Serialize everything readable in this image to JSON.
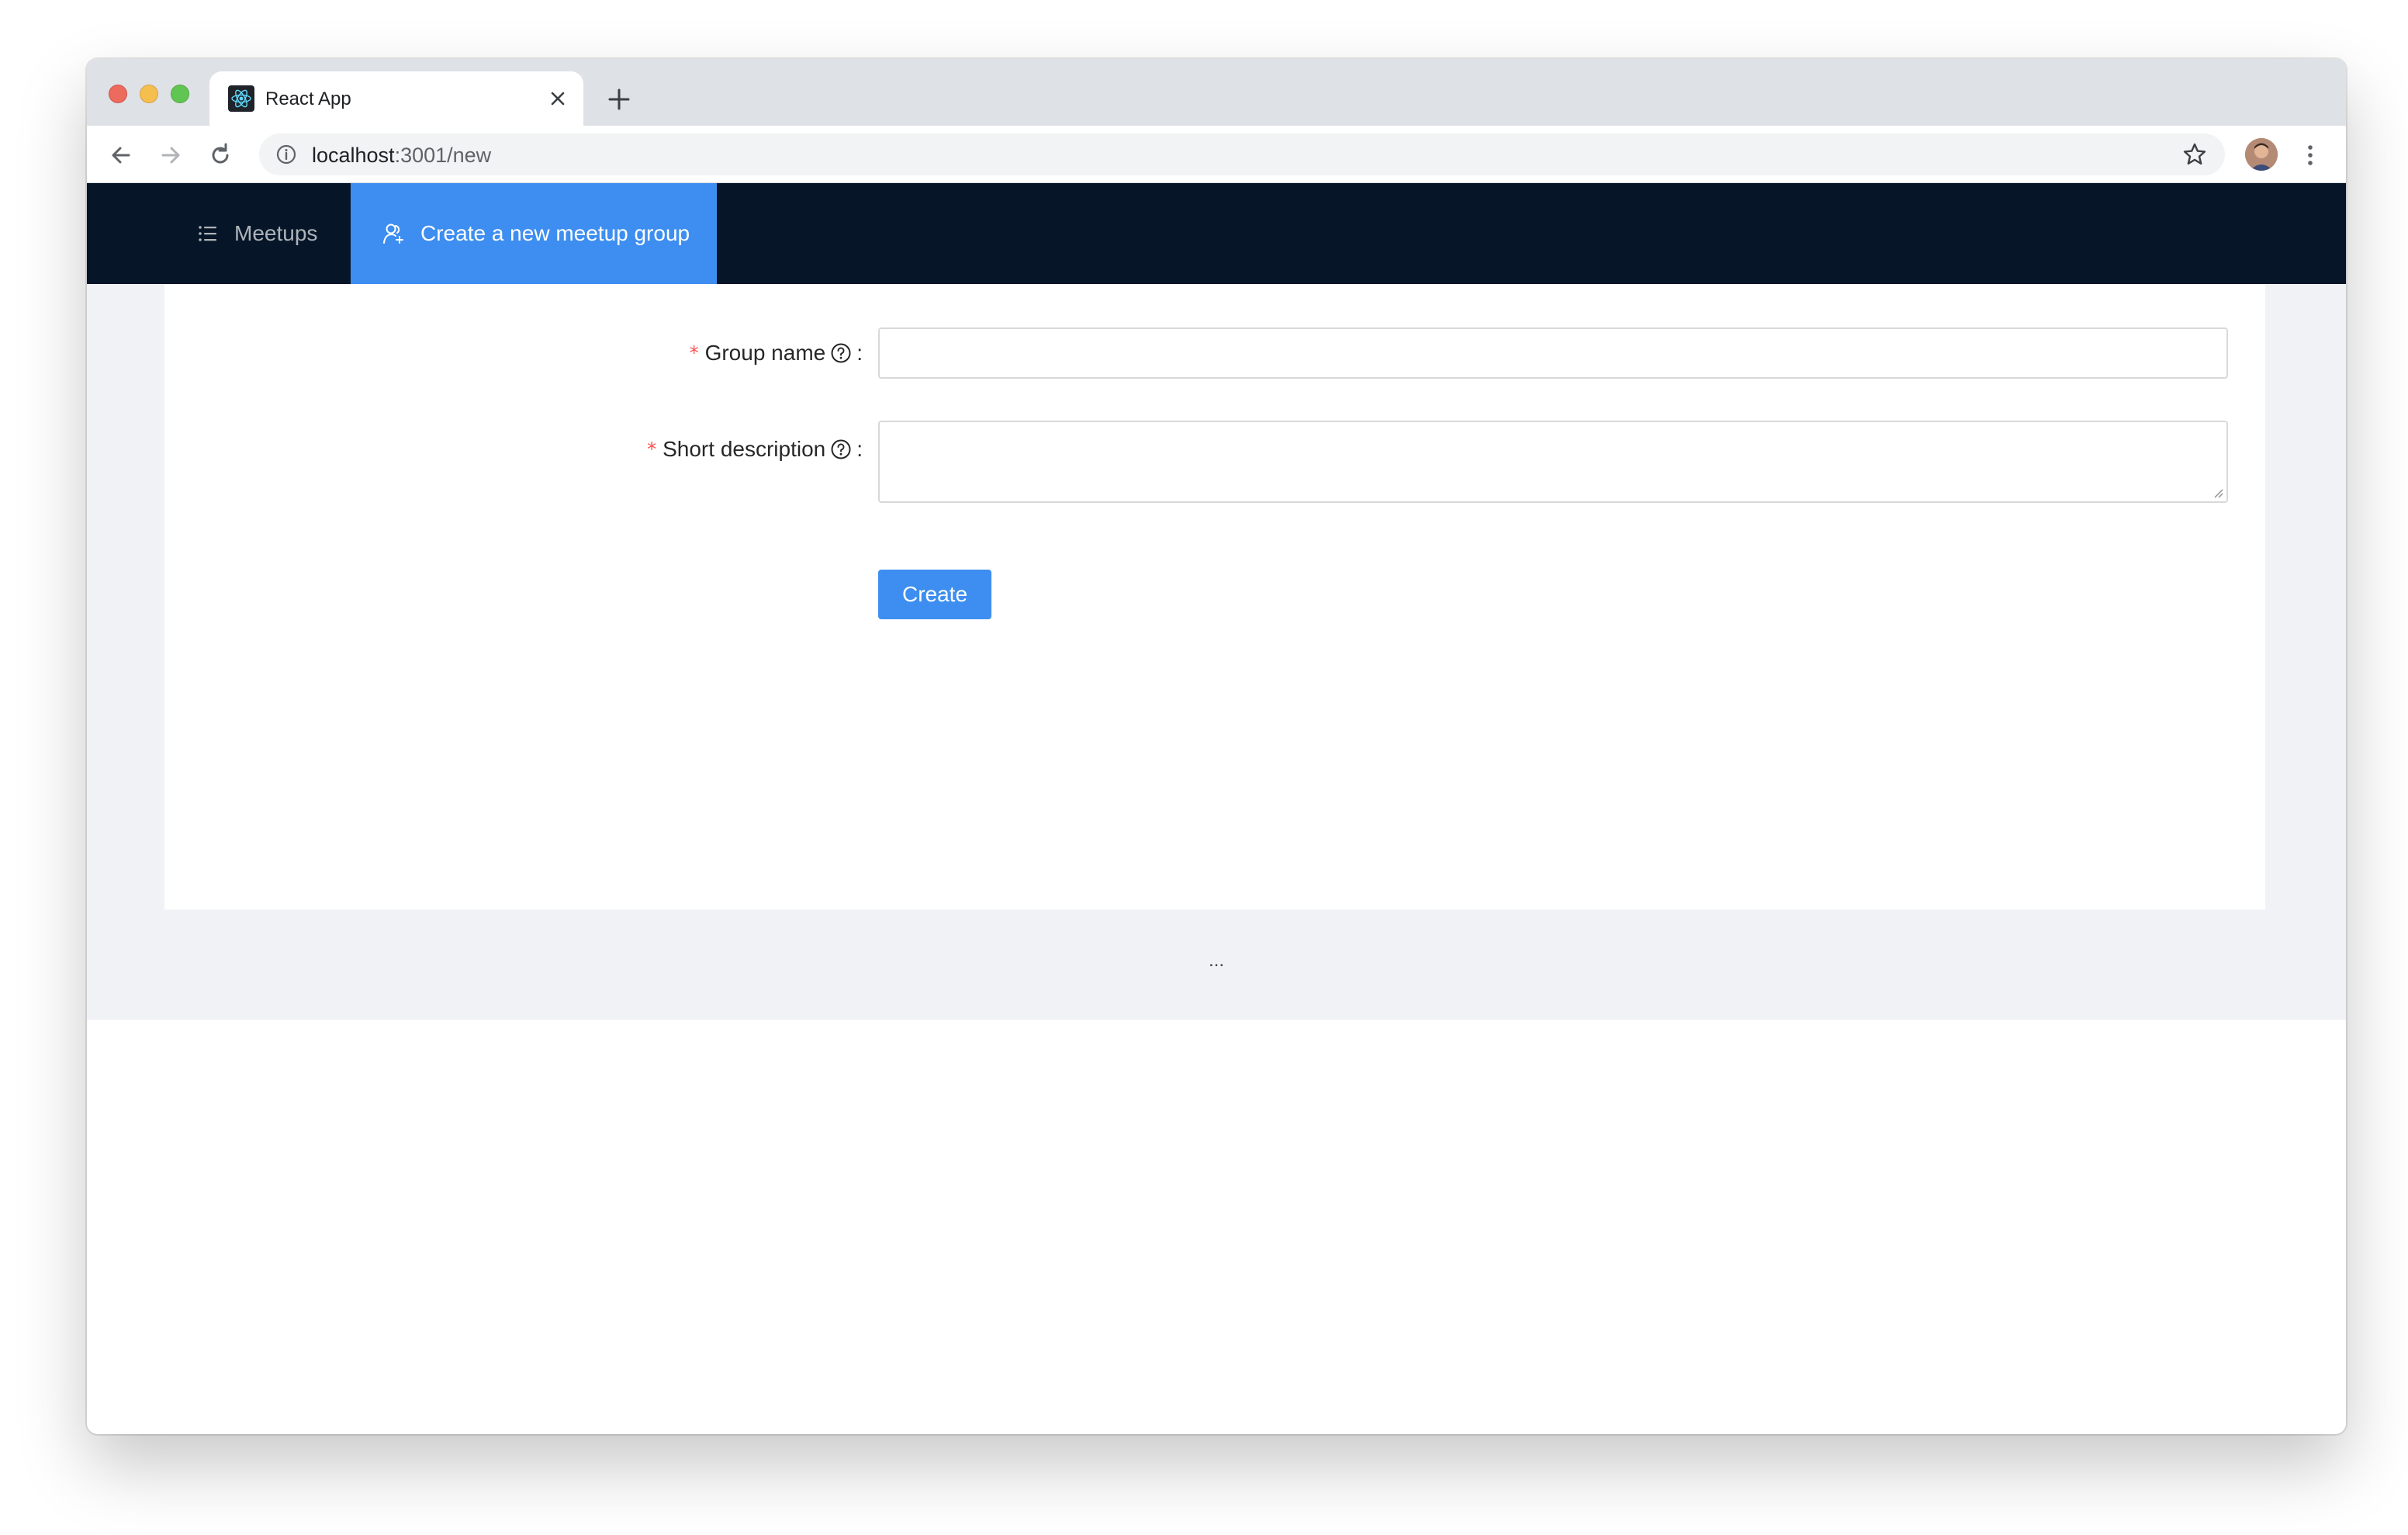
{
  "browser": {
    "tab_title": "React App",
    "url_host": "localhost",
    "url_path": ":3001/new"
  },
  "nav": {
    "items": [
      {
        "label": "Meetups",
        "icon": "unordered-list-icon"
      },
      {
        "label": "Create a new meetup group",
        "icon": "usergroup-add-icon",
        "active": true
      }
    ]
  },
  "form": {
    "group_name": {
      "label": "Group name",
      "value": "",
      "required": true
    },
    "short_description": {
      "label": "Short description",
      "value": "",
      "required": true
    },
    "submit_label": "Create"
  },
  "footer": {
    "text": "..."
  },
  "colors": {
    "header_bg": "#061527",
    "accent": "#3d8ef0",
    "layout_bg": "#f0f2f5",
    "required": "#ff4d4f"
  }
}
